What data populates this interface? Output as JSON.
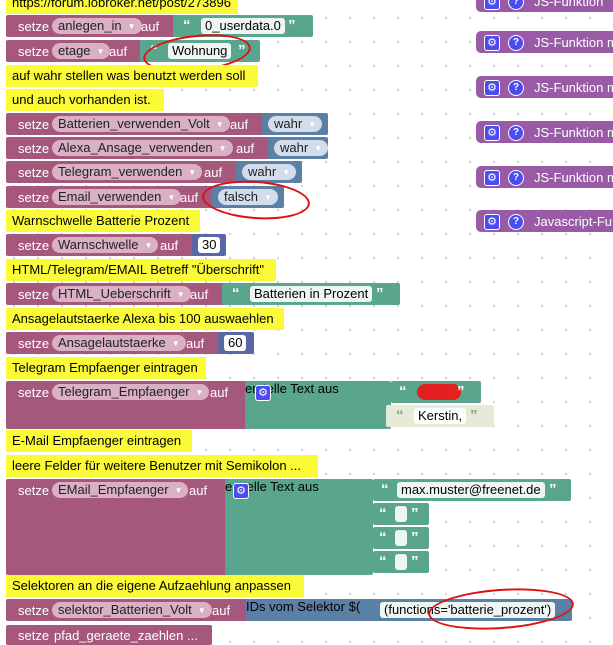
{
  "header_url": "https://forum.iobroker.net/post/273896",
  "kw": {
    "setze": "setze",
    "auf": "auf",
    "create_text": "erstelle Text aus",
    "ids_selector": "IDs vom Selektor $(",
    "quote_open": "“",
    "quote_close": "”"
  },
  "comments": {
    "true_set": "auf wahr stellen was benutzt werden soll",
    "true_set2": "und auch vorhanden ist.",
    "battery_warn": "Warnschwelle Batterie Prozent",
    "subject": "HTML/Telegram/EMAIL Betreff \"Überschrift\"",
    "alexa_volume": "Ansagelautstaerke Alexa bis 100 auswaehlen",
    "telegram_recv": "Telegram Empfaenger eintragen",
    "email_recv": "E-Mail Empfaenger eintragen",
    "empty_fields": "leere Felder für weitere Benutzer mit Semikolon ...",
    "selectors": "Selektoren an die eigene Aufzaehlung anpassen"
  },
  "vars": {
    "anlegen_in": "anlegen_in",
    "etage": "etage",
    "batt_volt": "Batterien_verwenden_Volt",
    "alexa": "Alexa_Ansage_verwenden",
    "telegram": "Telegram_verwenden",
    "email": "Email_verwenden",
    "warn": "Warnschwelle",
    "html_head": "HTML_Ueberschrift",
    "ansage": "Ansagelautstaerke",
    "tg_recv": "Telegram_Empfaenger",
    "email_recv": "EMail_Empfaenger",
    "selector_volt": "selektor_Batterien_Volt",
    "pfad": "pfad_geraete_zaehlen ..."
  },
  "values": {
    "anlegen_in": "0_userdata.0",
    "etage": "Wohnung",
    "batt_volt": "wahr",
    "alexa": "wahr",
    "telegram": "wahr",
    "email": "falsch",
    "warn": "30",
    "html_head": "Batterien in Prozent",
    "ansage": "60",
    "tg_recv_2": "Kerstin,",
    "email_recv_1": "max.muster@freenet.de",
    "selector_volt": "(functions='batterie_prozent')"
  },
  "side_blocks": [
    "JS-Funktion",
    "JS-Funktion m",
    "JS-Funktion m",
    "JS-Funktion m",
    "JS-Funktion m",
    "Javascript-Fu"
  ],
  "icons": {
    "gear": "gear-icon",
    "help": "help-icon",
    "dropdown": "chevron-down-icon"
  },
  "colors": {
    "comment": "#fbfa39",
    "variable_block": "#a5577c",
    "text_block": "#5aa58d",
    "logic_block": "#5b80a5",
    "math_block": "#5b67a5",
    "function_block": "#995ba5",
    "annotation_red": "#e01010"
  }
}
